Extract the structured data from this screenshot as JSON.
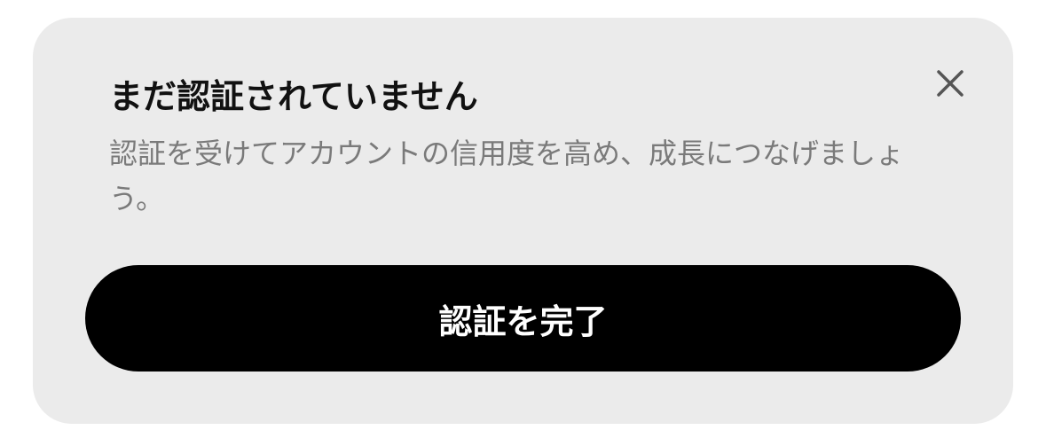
{
  "banner": {
    "title": "まだ認証されていません",
    "description": "認証を受けてアカウントの信用度を高め、成長につなげましょう。",
    "close_icon": "close-icon",
    "button_label": "認証を完了",
    "colors": {
      "card_background": "#ebebeb",
      "title_text": "#111111",
      "description_text": "#7a7a7a",
      "button_background": "#000000",
      "button_text": "#ffffff",
      "close_icon": "#555555"
    }
  }
}
